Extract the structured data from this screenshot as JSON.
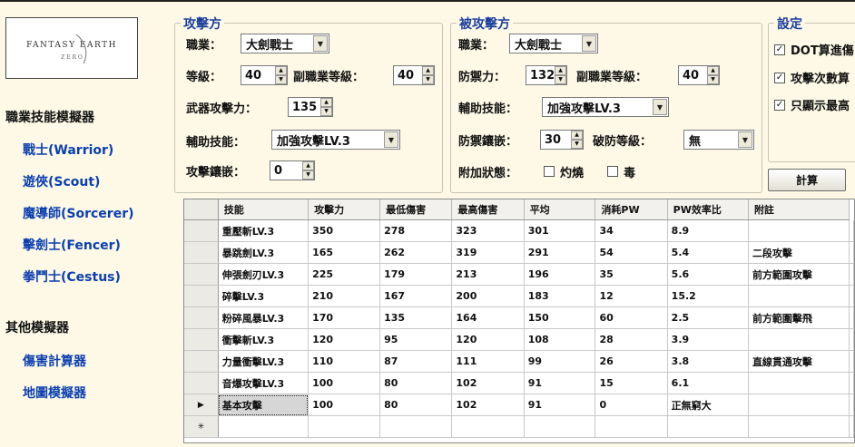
{
  "nav": {
    "logo_text": "FANTASY EARTH",
    "logo_sub": "Z E R O",
    "section1": "職業技能模擬器",
    "classes": [
      "戰士(Warrior)",
      "遊俠(Scout)",
      "魔導師(Sorcerer)",
      "擊劍士(Fencer)",
      "拳鬥士(Cestus)"
    ],
    "section2": "其他模擬器",
    "others": [
      "傷害計算器",
      "地圖模擬器"
    ]
  },
  "attacker": {
    "legend": "攻擊方",
    "job_label": "職業：",
    "job_value": "大劍戰士",
    "level_label": "等級：",
    "level_value": "40",
    "sub_level_label": "副職業等級：",
    "sub_level_value": "40",
    "weapon_label": "武器攻擊力：",
    "weapon_value": "135",
    "support_label": "輔助技能：",
    "support_value": "加強攻擊LV.3",
    "inlay_label": "攻擊鑲嵌：",
    "inlay_value": "0"
  },
  "defender": {
    "legend": "被攻擊方",
    "job_label": "職業：",
    "job_value": "大劍戰士",
    "def_label": "防禦力：",
    "def_value": "132",
    "sub_level_label": "副職業等級：",
    "sub_level_value": "40",
    "support_label": "輔助技能：",
    "support_value": "加強攻擊LV.3",
    "inlay_label": "防禦鑲嵌：",
    "inlay_value": "30",
    "break_label": "破防等級：",
    "break_value": "無",
    "status_label": "附加狀態：",
    "burn_label": "灼燒",
    "poison_label": "毒"
  },
  "settings": {
    "legend": "設定",
    "opt1": "DOT算進傷",
    "opt2": "攻擊次數算",
    "opt3": "只顯示最高"
  },
  "calc_button": "計算",
  "table": {
    "columns": [
      "技能",
      "攻擊力",
      "最低傷害",
      "最高傷害",
      "平均",
      "消耗PW",
      "PW效率比",
      "附註"
    ],
    "rows": [
      [
        "重壓斬LV.3",
        "350",
        "278",
        "323",
        "301",
        "34",
        "8.9",
        ""
      ],
      [
        "暴跳劍LV.3",
        "165",
        "262",
        "319",
        "291",
        "54",
        "5.4",
        "二段攻擊"
      ],
      [
        "伸張劍刃LV.3",
        "225",
        "179",
        "213",
        "196",
        "35",
        "5.6",
        "前方範圍攻擊"
      ],
      [
        "碎擊LV.3",
        "210",
        "167",
        "200",
        "183",
        "12",
        "15.2",
        ""
      ],
      [
        "粉碎風暴LV.3",
        "170",
        "135",
        "164",
        "150",
        "60",
        "2.5",
        "前方範圍擊飛"
      ],
      [
        "衝擊斬LV.3",
        "120",
        "95",
        "120",
        "108",
        "28",
        "3.9",
        ""
      ],
      [
        "力量衝擊LV.3",
        "110",
        "87",
        "111",
        "99",
        "26",
        "3.8",
        "直線貫通攻擊"
      ],
      [
        "音爆攻擊LV.3",
        "100",
        "80",
        "102",
        "91",
        "15",
        "6.1",
        ""
      ],
      [
        "基本攻擊",
        "100",
        "80",
        "102",
        "91",
        "0",
        "正無窮大",
        ""
      ]
    ],
    "current_row_marker": "▶",
    "new_row_marker": "✳"
  },
  "icons": {
    "dropdown": "chevron-down-icon",
    "spin_up": "arrow-up-icon",
    "spin_down": "arrow-down-icon",
    "check": "check-icon"
  }
}
